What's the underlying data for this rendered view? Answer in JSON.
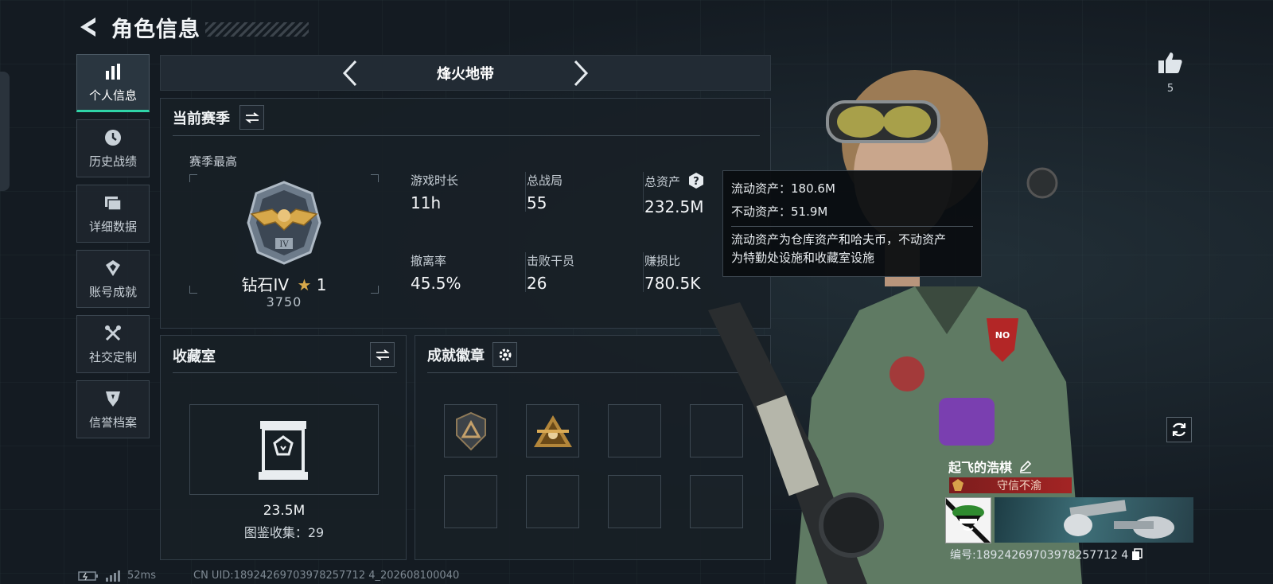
{
  "header": {
    "title": "角色信息"
  },
  "nav": {
    "items": [
      {
        "label": "个人信息",
        "icon": "bar-chart-icon",
        "active": true
      },
      {
        "label": "历史战绩",
        "icon": "history-icon",
        "active": false
      },
      {
        "label": "详细数据",
        "icon": "folder-icon",
        "active": false
      },
      {
        "label": "账号成就",
        "icon": "achievement-icon",
        "active": false
      },
      {
        "label": "社交定制",
        "icon": "tools-icon",
        "active": false
      },
      {
        "label": "信誉档案",
        "icon": "credit-icon",
        "active": false
      }
    ]
  },
  "mode": {
    "title": "烽火地带"
  },
  "season": {
    "title": "当前赛季",
    "best_label": "赛季最高",
    "rank_name": "钻石IV",
    "rank_stars": "1",
    "rank_score": "3750",
    "stats": [
      {
        "label": "游戏时长",
        "value": "11h"
      },
      {
        "label": "总战局",
        "value": "55"
      },
      {
        "label": "总资产",
        "value": "232.5M"
      },
      {
        "label": "撤离率",
        "value": "45.5%"
      },
      {
        "label": "击败干员",
        "value": "26"
      },
      {
        "label": "赚损比",
        "value": "780.5K"
      }
    ]
  },
  "tooltip": {
    "liquid": "流动资产：180.6M",
    "fixed": "不动资产：51.9M",
    "desc_line1": "流动资产为仓库资产和哈夫币，不动资产",
    "desc_line2": "为特勤处设施和收藏室设施"
  },
  "collection": {
    "title": "收藏室",
    "value": "23.5M",
    "count": "图鉴收集：29"
  },
  "badges": {
    "title": "成就徽章"
  },
  "like": {
    "count": "5"
  },
  "player": {
    "name": "起飞的浩棋",
    "honor": "守信不渝",
    "id": "编号:18924269703978257712 4"
  },
  "footer": {
    "ping": "52ms",
    "uid": "CN UID:18924269703978257712 4_202608100040"
  },
  "colors": {
    "accent": "#2fd5a8",
    "honor": "#a32424",
    "gold": "#d7a84a"
  }
}
